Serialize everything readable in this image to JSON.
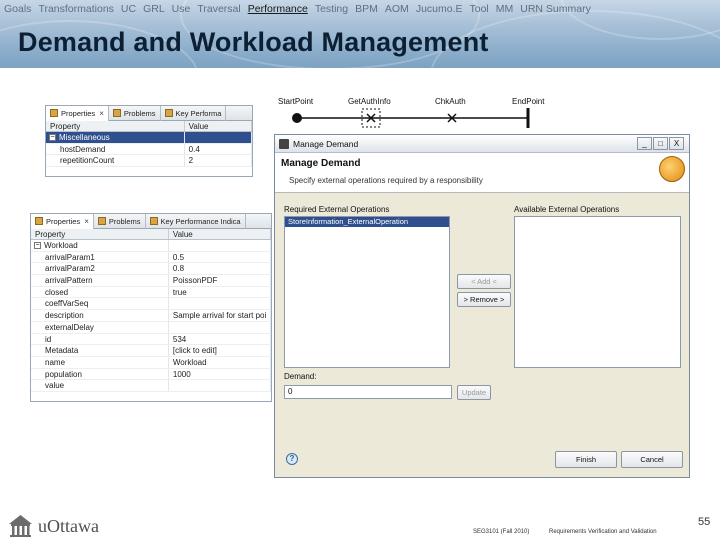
{
  "nav": {
    "items": [
      "Goals",
      "Transformations",
      "UC",
      "GRL",
      "Use",
      "Traversal",
      "Performance",
      "Testing",
      "BPM",
      "AOM",
      "Jucumo.E",
      "Tool",
      "MM",
      "URN Summary"
    ],
    "current": "Performance"
  },
  "slide": {
    "title": "Demand and Workload Management",
    "page_number": "55",
    "course": "SEG3101 (Fall 2010)",
    "topic": "Requirements Verification and Validation",
    "institution": "uOttawa"
  },
  "properties_top": {
    "tabs": [
      "Properties",
      "Problems",
      "Key Performa"
    ],
    "columns": [
      "Property",
      "Value"
    ],
    "rows": [
      {
        "prop": "Miscellaneous",
        "value": "",
        "group": true,
        "selected": true
      },
      {
        "prop": "hostDemand",
        "value": "0.4"
      },
      {
        "prop": "repetitionCount",
        "value": "2"
      }
    ]
  },
  "properties_bottom": {
    "tabs": [
      "Properties",
      "Problems",
      "Key Performance Indica"
    ],
    "columns": [
      "Property",
      "Value"
    ],
    "rows": [
      {
        "prop": "Workload",
        "value": "",
        "group": true
      },
      {
        "prop": "arrivalParam1",
        "value": "0.5"
      },
      {
        "prop": "arrivalParam2",
        "value": "0.8"
      },
      {
        "prop": "arrivalPattern",
        "value": "PoissonPDF"
      },
      {
        "prop": "closed",
        "value": "true"
      },
      {
        "prop": "coeffVarSeq",
        "value": ""
      },
      {
        "prop": "description",
        "value": "Sample arrival for start poi"
      },
      {
        "prop": "externalDelay",
        "value": ""
      },
      {
        "prop": "id",
        "value": "534"
      },
      {
        "prop": "Metadata",
        "value": "[click to edit]"
      },
      {
        "prop": "name",
        "value": "Workload"
      },
      {
        "prop": "population",
        "value": "1000"
      },
      {
        "prop": "value",
        "value": ""
      }
    ]
  },
  "map": {
    "labels": [
      "StartPoint",
      "GetAuthInfo",
      "ChkAuth",
      "EndPoint"
    ]
  },
  "dialog": {
    "window_title": "Manage Demand",
    "header_title": "Manage Demand",
    "header_desc": "Specify external operations required by a responsibility",
    "required_label": "Required External Operations",
    "available_label": "Available External Operations",
    "required_items": [
      "StoreInformation_ExternalOperation"
    ],
    "available_items": [],
    "add_button": "< Add <",
    "remove_button": "> Remove >",
    "demand_label": "Demand:",
    "demand_value": "0",
    "update_button": "Update",
    "finish_button": "Finish",
    "cancel_button": "Cancel",
    "help_glyph": "?",
    "minimize_glyph": "_",
    "maximize_glyph": "□",
    "close_glyph": "X"
  }
}
